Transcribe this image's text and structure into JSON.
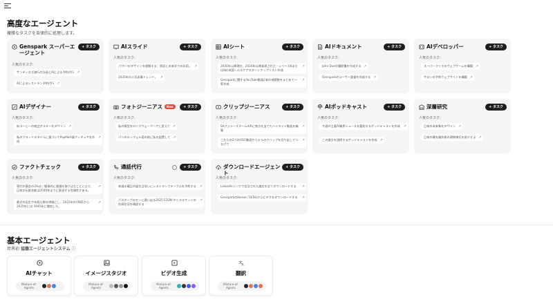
{
  "advanced": {
    "title": "高度なエージェント",
    "subtitle": "複雑なタスクを自律的に処理します。"
  },
  "task_label": "+ タスク",
  "examples_label": "人気のタスク:",
  "new_badge": "New",
  "cards": [
    {
      "title": "Genspark スーパーエージェント",
      "icon": "sparkle-chat-icon",
      "chips": [
        "サンディエゴ旅行の計画とAIによる予約代行",
        "AIによるレストラン予約代行"
      ]
    },
    {
      "title": "AIスライド",
      "icon": "slides-icon",
      "chips": [
        "パワハラ/デザインを理解する：原因と未来学での応用。",
        "2025年の人気返事トレンド。"
      ]
    },
    {
      "title": "AIシート",
      "icon": "grid-sheet-icon",
      "chips": [
        "2020年以降現在、2024年以降発表された・シリーズ8またはBの米国ヘルスケアスタートアップリスト作成",
        "Gensparkに関するYouTube動画2本の視聴数をまとめて一覧作成"
      ]
    },
    {
      "title": "AIドキュメント",
      "icon": "document-icon",
      "chips": [
        "John Doeの履歴書を作成する",
        "Gensparkのユーザー調査を作成する"
      ]
    },
    {
      "title": "AIデベロッパー",
      "icon": "developer-icon",
      "chips": [
        "スーパーマリオのウェブゲームを構築",
        "サロンの予約ウェブサイトを構築"
      ]
    },
    {
      "title": "AIデザイナー",
      "icon": "designer-icon",
      "chips": [
        "街コーヒーの商品ポスターをデザイン",
        "私のブランドスタイルに基づいてPopMart風フィギュアを作成"
      ]
    },
    {
      "title": "フォトジーニアス",
      "icon": "camera-icon",
      "chips": [
        "私の髪型をロングウェーブヘアに変えて",
        "パリのエッフェル塔の前に私を配置して"
      ]
    },
    {
      "title": "クリップジーニアス",
      "icon": "clip-icon",
      "chips": [
        "SAクジャーズチームのRに焦点を当てたハイライト動画を編集",
        "これらの2つのUGC動画からキルのクリップを切り出してつなげて"
      ]
    },
    {
      "title": "AIポッドキャスト",
      "icon": "podcast-icon",
      "chips": [
        "今週の主要AI業界ニュースを要約するポッドキャストを作成",
        "この論文を説明するポッドキャストを作成"
      ]
    },
    {
      "title": "深層研究",
      "icon": "research-icon",
      "chips": [
        "日本の未来象をデザイン",
        "日本の最先端技術の建物様式を紹介せよ"
      ]
    },
    {
      "title": "ファクトチェック",
      "icon": "factcheck-icon",
      "chips": [
        "現代の基金の3%は、間接的に意識を取り込むことにより、日本の伝統芸能は2040年までに衰退する危険性がある。",
        "最近の出生や年経与数を明確にし、2022年の1985から2025年には 3945年に増加した。"
      ]
    },
    {
      "title": "通話代行",
      "icon": "phone-icon",
      "chips": [
        "来週水曜日の誕生日祝いにレストランでテーブルを予約する",
        "パスターブロモンに通い出る2025 E2ON:テニスラケットの在庫状況を確認する"
      ]
    },
    {
      "title": "ダウンロードエージェント",
      "icon": "cloud-download-icon",
      "chips": [
        "LinkedInリンクで言及された論文を全てダウンロードする",
        "GensparkのKorean TikTokからビデオをダウンロードする"
      ]
    }
  ],
  "basic": {
    "title": "基本エージェント",
    "subtitle_prefix": "世界初",
    "subtitle_bold": "協働エージェントシステム",
    "moa_label": "Mixture-of-Agents",
    "cards": [
      {
        "title": "AIチャット",
        "icon": "chat-icon"
      },
      {
        "title": "イメージスタジオ",
        "icon": "image-studio-icon"
      },
      {
        "title": "ビデオ生成",
        "icon": "video-icon"
      },
      {
        "title": "翻訳",
        "icon": "translate-icon"
      }
    ]
  },
  "colors": {
    "task_button": "#1e1e1e",
    "new_badge": "#e64b3c",
    "card_bg": "#f5f5f5"
  }
}
